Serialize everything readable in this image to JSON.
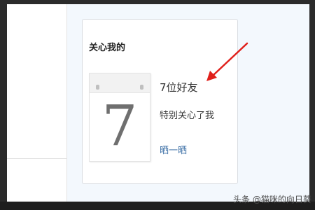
{
  "card": {
    "title": "关心我的",
    "calendar_day": "7",
    "friend_count_label": "7位好友",
    "description": "特别关心了我",
    "share_link": "晒一晒"
  },
  "watermark": {
    "text": "头条 @猫咪的向日葵"
  },
  "colors": {
    "panel_bg": "#f3f8fd",
    "link": "#3a6ea5",
    "arrow": "#e0201b",
    "frame": "#2b2b2b"
  },
  "icons": {
    "calendar": "calendar-icon",
    "annotation": "red-arrow-icon"
  }
}
